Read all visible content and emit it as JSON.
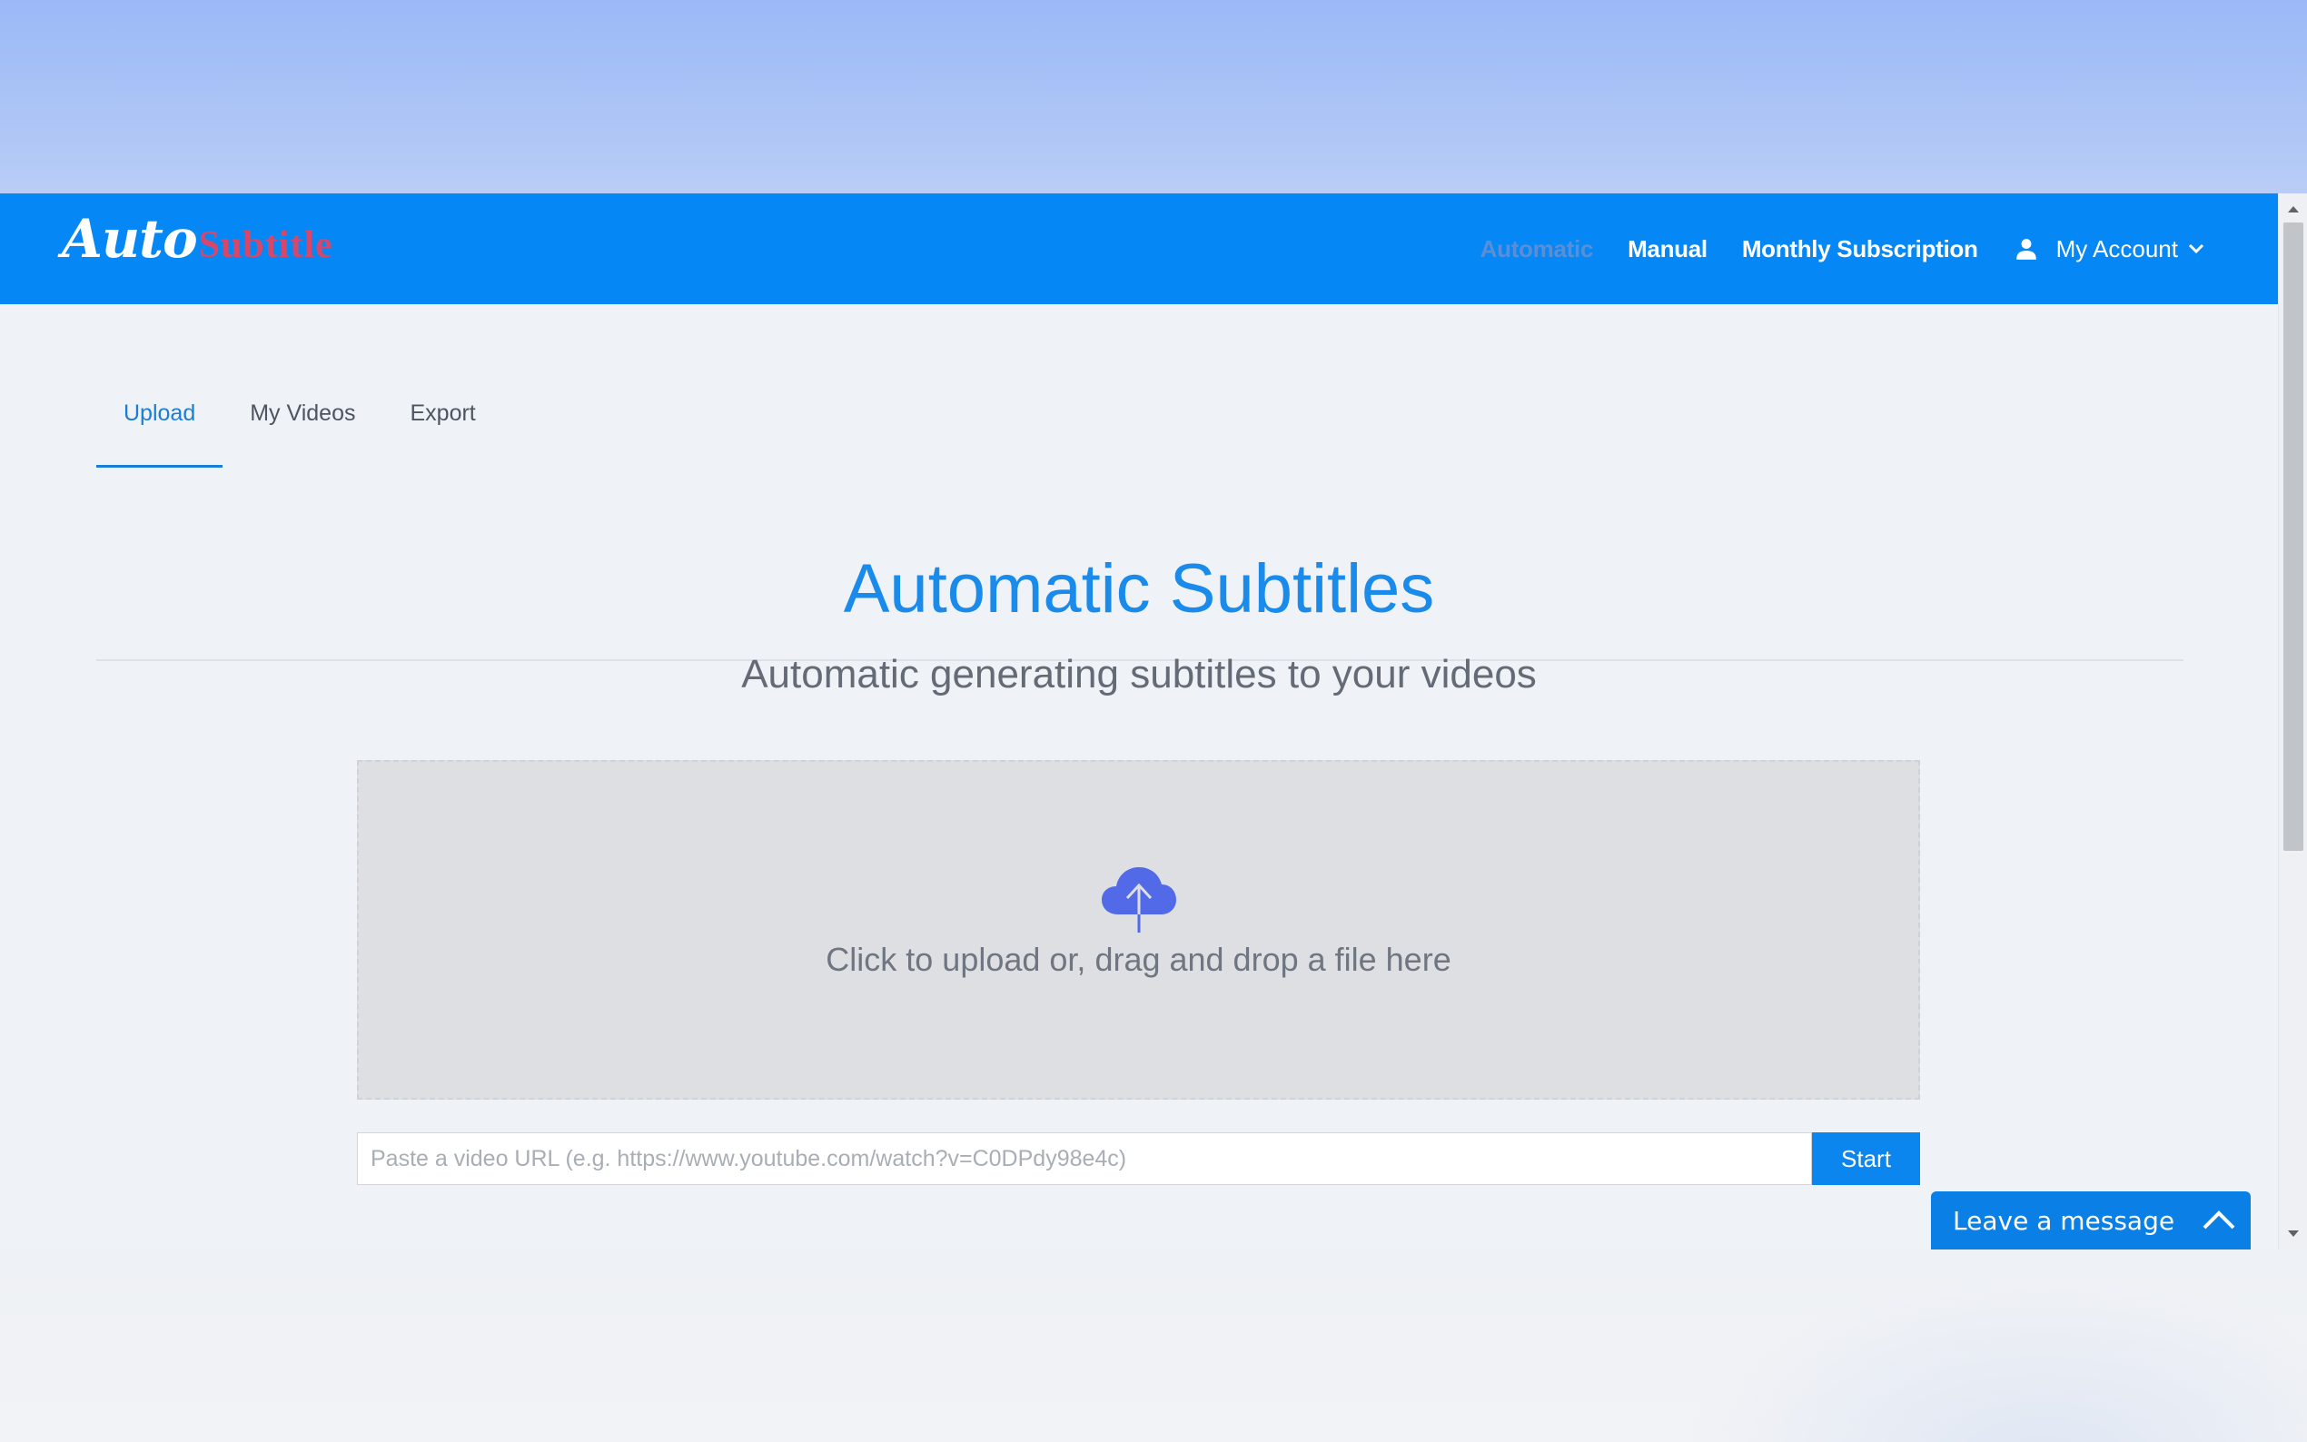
{
  "logo": {
    "part1": "Auto",
    "part2": "Subtitle"
  },
  "nav": {
    "items": [
      {
        "label": "Automatic",
        "active": true
      },
      {
        "label": "Manual",
        "active": false
      },
      {
        "label": "Monthly Subscription",
        "active": false
      }
    ],
    "account_label": "My Account",
    "account_icon": "user-icon"
  },
  "tabs": [
    {
      "label": "Upload",
      "active": true
    },
    {
      "label": "My Videos",
      "active": false
    },
    {
      "label": "Export",
      "active": false
    }
  ],
  "hero": {
    "title": "Automatic Subtitles",
    "subtitle": "Automatic generating subtitles to your videos"
  },
  "dropzone": {
    "icon": "cloud-upload-icon",
    "text": "Click to upload or, drag and drop a file here"
  },
  "url_form": {
    "placeholder": "Paste a video URL (e.g. https://www.youtube.com/watch?v=C0DPdy98e4c)",
    "value": "",
    "button_label": "Start"
  },
  "chat": {
    "label": "Leave a message"
  },
  "colors": {
    "navbar": "#0588f5",
    "accent": "#1a8bea",
    "nav_active": "#5a8fd8",
    "logo_secondary": "#d6476a"
  }
}
